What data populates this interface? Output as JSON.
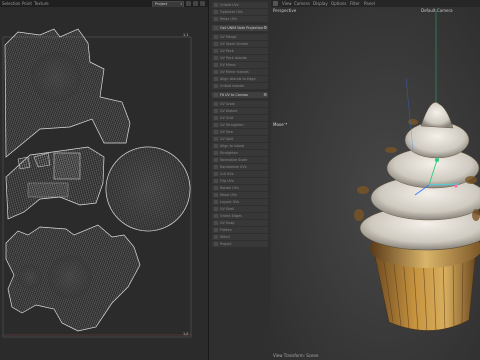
{
  "top_menu": {
    "left_items": [
      "Selection",
      "Point",
      "Texture"
    ],
    "dropdown_value": "Project"
  },
  "uv_editor": {
    "corner_top_right": "1,1",
    "corner_bottom_right": "1,0"
  },
  "tools": {
    "items": [
      {
        "label": "Unfold UVs",
        "active": false
      },
      {
        "label": "Optimize UVs",
        "active": false
      },
      {
        "label": "Relax UVs",
        "active": false
      },
      {
        "label": "Get UNIM Note Projection",
        "active": true
      },
      {
        "label": "UV Merge",
        "active": false
      },
      {
        "label": "UV Stack Similar",
        "active": false
      },
      {
        "label": "UV Pack",
        "active": false
      },
      {
        "label": "UV Pack Islands",
        "active": false
      },
      {
        "label": "UV Mirror",
        "active": false
      },
      {
        "label": "UV Mirror Islands",
        "active": false
      },
      {
        "label": "Align Islands to Edge",
        "active": false
      },
      {
        "label": "Unfold Islands",
        "active": false
      },
      {
        "label": "Fit UV to Canvas",
        "active": true
      },
      {
        "label": "UV Scale",
        "active": false
      },
      {
        "label": "UV Distort",
        "active": false
      },
      {
        "label": "UV Grid",
        "active": false
      },
      {
        "label": "UV Straighten",
        "active": false
      },
      {
        "label": "UV Sew",
        "active": false
      },
      {
        "label": "UV Split",
        "active": false
      },
      {
        "label": "Align to Island",
        "active": false
      },
      {
        "label": "Straighten",
        "active": false
      },
      {
        "label": "Normalize Scale",
        "active": false
      },
      {
        "label": "Randomize UVs",
        "active": false
      },
      {
        "label": "Cut UVs",
        "active": false
      },
      {
        "label": "Flip UVs",
        "active": false
      },
      {
        "label": "Rotate UVs",
        "active": false
      },
      {
        "label": "Move UVs",
        "active": false
      },
      {
        "label": "Layout UVs",
        "active": false
      },
      {
        "label": "UV Shell",
        "active": false
      },
      {
        "label": "Orient Edges",
        "active": false
      },
      {
        "label": "UV Snap",
        "active": false
      },
      {
        "label": "Flatten",
        "active": false
      },
      {
        "label": "Stitch",
        "active": false
      },
      {
        "label": "Project",
        "active": false
      }
    ]
  },
  "viewport": {
    "menu_items": [
      "View",
      "Camera",
      "Display",
      "Options",
      "Filter",
      "Panel"
    ],
    "perspective_label": "Perspective",
    "camera_label": "Default Camera",
    "move_label": "Move",
    "bottom_label": "View Transform: Scene"
  },
  "colors": {
    "uv_background": "#2b2b2b",
    "uv_wire": "#bdbdbd",
    "viewport_bg": "#3a3a3a",
    "axis_green": "#2bd07a",
    "axis_blue": "#3a7bff",
    "axis_cyan": "#47d0e0"
  }
}
